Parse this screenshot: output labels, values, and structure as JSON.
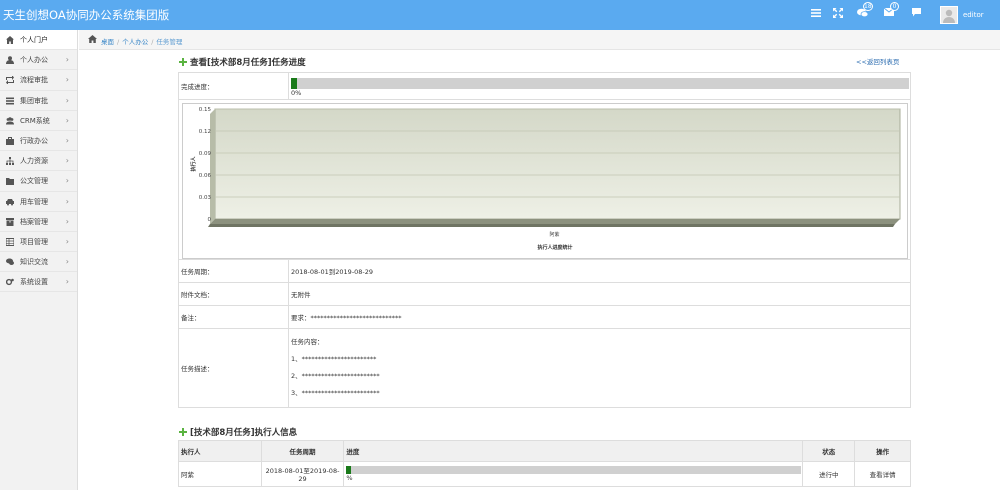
{
  "app": {
    "title": "天生创想OA协同办公系统集团版",
    "username": "editor",
    "badges": {
      "chat": "18",
      "mail": "0"
    }
  },
  "sidebar": {
    "items": [
      {
        "label": "个人门户",
        "icon": "home-icon",
        "active": true
      },
      {
        "label": "个人办公",
        "icon": "user-icon"
      },
      {
        "label": "流程审批",
        "icon": "retweet-icon"
      },
      {
        "label": "集团审批",
        "icon": "list-icon"
      },
      {
        "label": "CRM系统",
        "icon": "group-icon"
      },
      {
        "label": "行政办公",
        "icon": "briefcase-icon"
      },
      {
        "label": "人力资源",
        "icon": "sitemap-icon"
      },
      {
        "label": "公文管理",
        "icon": "folder-icon"
      },
      {
        "label": "用车管理",
        "icon": "car-icon"
      },
      {
        "label": "档案管理",
        "icon": "archive-icon"
      },
      {
        "label": "项目管理",
        "icon": "table-icon"
      },
      {
        "label": "知识交流",
        "icon": "comments-icon"
      },
      {
        "label": "系统设置",
        "icon": "cogs-icon"
      }
    ]
  },
  "breadcrumb": {
    "home": "桌面",
    "parent": "个人办公",
    "current": "任务管理"
  },
  "progress_section": {
    "title": "查看[技术部8月任务]任务进度",
    "back_link": "<<返回列表页",
    "progress_label": "完成进度：",
    "progress_value": 0.01,
    "progress_text": "0%"
  },
  "chart_data": {
    "type": "bar",
    "title": "",
    "xlabel": "执行人进度统计",
    "ylabel": "执行人",
    "categories": [
      "阿紫"
    ],
    "values": [
      0
    ],
    "ylim": [
      0,
      0.15
    ],
    "yticks": [
      "0.15",
      "0.12",
      "0.09",
      "0.06",
      "0.03",
      "0"
    ],
    "grid": true
  },
  "details": {
    "period_label": "任务周期：",
    "period_value": "2018-08-01到2019-08-29",
    "attach_label": "附件文档：",
    "attach_value": "无附件",
    "note_label": "备注：",
    "note_value": "要求：****************************",
    "desc_label": "任务描述：",
    "desc_lines": [
      "任务内容：",
      "1、***********************",
      "2、************************",
      "3、************************"
    ]
  },
  "executor_section": {
    "title": "[技术部8月任务]执行人信息",
    "headers": [
      "执行人",
      "任务周期",
      "进度",
      "状态",
      "操作"
    ],
    "rows": [
      {
        "name": "阿紫",
        "period": "2018-08-01至2019-08-29",
        "progress": 0.01,
        "progress_text": "%",
        "status": "进行中",
        "action": "查看详情"
      }
    ]
  }
}
